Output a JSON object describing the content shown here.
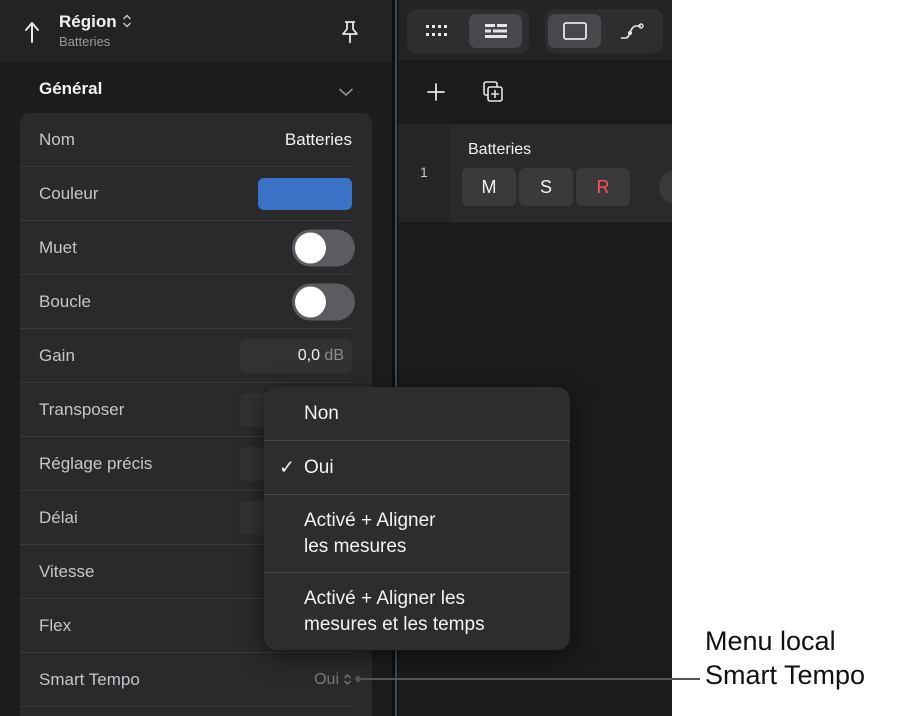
{
  "inspector": {
    "title": "Région",
    "subtitle": "Batteries",
    "section": "Général",
    "rows": {
      "nom": {
        "label": "Nom",
        "value": "Batteries"
      },
      "couleur": {
        "label": "Couleur",
        "color": "#3a73c6"
      },
      "muet": {
        "label": "Muet",
        "on": false
      },
      "boucle": {
        "label": "Boucle",
        "on": false
      },
      "gain": {
        "label": "Gain",
        "value": "0,0",
        "unit": "dB"
      },
      "transposer": {
        "label": "Transposer"
      },
      "reglage": {
        "label": "Réglage précis"
      },
      "delai": {
        "label": "Délai"
      },
      "vitesse": {
        "label": "Vitesse"
      },
      "flex": {
        "label": "Flex"
      },
      "smart_tempo": {
        "label": "Smart Tempo",
        "value": "Oui"
      }
    }
  },
  "track": {
    "number": "1",
    "name": "Batteries",
    "mute": "M",
    "solo": "S",
    "record": "R"
  },
  "popup_menu": {
    "items": [
      {
        "label": "Non",
        "checked": false
      },
      {
        "label": "Oui",
        "checked": true
      },
      {
        "label": "Activé + Aligner\nles mesures",
        "checked": false
      },
      {
        "label": "Activé + Aligner les\nmesures et les temps",
        "checked": false
      }
    ],
    "checkmark": "✓"
  },
  "callout": {
    "text": "Menu local\nSmart Tempo"
  },
  "colors": {
    "accent": "#3a73c6",
    "record": "#ff5257",
    "background": "#1c1c1e"
  }
}
